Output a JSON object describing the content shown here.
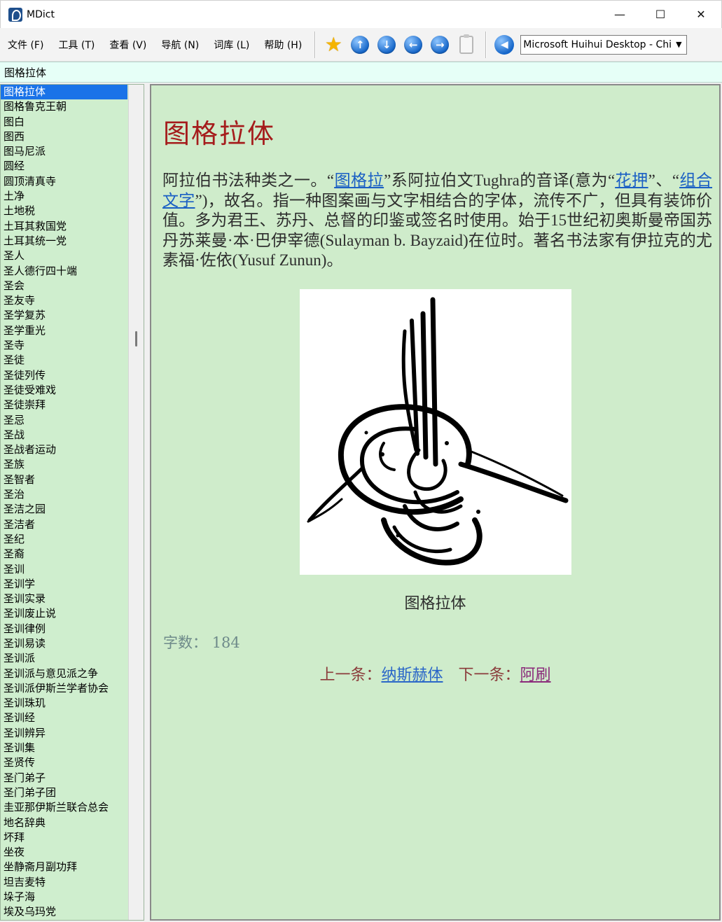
{
  "window": {
    "title": "MDict"
  },
  "menu": [
    {
      "label": "文件",
      "key": "(F)"
    },
    {
      "label": "工具",
      "key": "(T)"
    },
    {
      "label": "查看",
      "key": "(V)"
    },
    {
      "label": "导航",
      "key": "(N)"
    },
    {
      "label": "词库",
      "key": "(L)"
    },
    {
      "label": "帮助",
      "key": "(H)"
    }
  ],
  "toolbar": {
    "voice": "Microsoft Huihui Desktop - Chinese (Simplified)",
    "icons": [
      "star-icon",
      "arrow-up-icon",
      "arrow-down-icon",
      "arrow-left-icon",
      "arrow-right-icon",
      "clipboard-icon",
      "speaker-icon"
    ]
  },
  "search": {
    "value": "图格拉体"
  },
  "wordlist": [
    "图格拉体",
    "图格鲁克王朝",
    "图白",
    "图西",
    "图马尼派",
    "圆经",
    "圆顶清真寺",
    "土净",
    "土地税",
    "土耳其救国党",
    "土耳其统一党",
    "圣人",
    "圣人德行四十端",
    "圣会",
    "圣友寺",
    "圣学复苏",
    "圣学重光",
    "圣寺",
    "圣徒",
    "圣徒列传",
    "圣徒受难戏",
    "圣徒崇拜",
    "圣忌",
    "圣战",
    "圣战者运动",
    "圣族",
    "圣智者",
    "圣治",
    "圣洁之园",
    "圣洁者",
    "圣纪",
    "圣裔",
    "圣训",
    "圣训学",
    "圣训实录",
    "圣训废止说",
    "圣训律例",
    "圣训易读",
    "圣训派",
    "圣训派与意见派之争",
    "圣训派伊斯兰学者协会",
    "圣训珠玑",
    "圣训经",
    "圣训辨异",
    "圣训集",
    "圣贤传",
    "圣门弟子",
    "圣门弟子团",
    "圭亚那伊斯兰联合总会",
    "地名辞典",
    "坏拜",
    "坐夜",
    "坐静斋月副功拜",
    "坦吉麦特",
    "垛子海",
    "埃及乌玛党"
  ],
  "entry": {
    "title": "图格拉体",
    "body": {
      "p1": "阿拉伯书法种类之一。“",
      "link1": "图格拉",
      "p2": "”系阿拉伯文Tughra的音译(意为“",
      "link2": "花押",
      "p3": "”、“",
      "link3": "组合文字",
      "p4": "”)，故名。指一种图案画与文字相结合的字体，流传不广，但具有装饰价值。多为君王、苏丹、总督的印鉴或签名时使用。始于15世纪初奥斯曼帝国苏丹苏莱曼·本·巴伊宰德(Sulayman b. Bayzaid)在位时。著名书法家有伊拉克的尤素福·佐依(Yusuf Zunun)。"
    },
    "figure_caption": "图格拉体",
    "wordcount_label": "字数：",
    "wordcount_value": "184",
    "prev_label": "上一条：",
    "prev_link": "纳斯赫体",
    "next_label": "下一条：",
    "next_link": "阿刷"
  }
}
